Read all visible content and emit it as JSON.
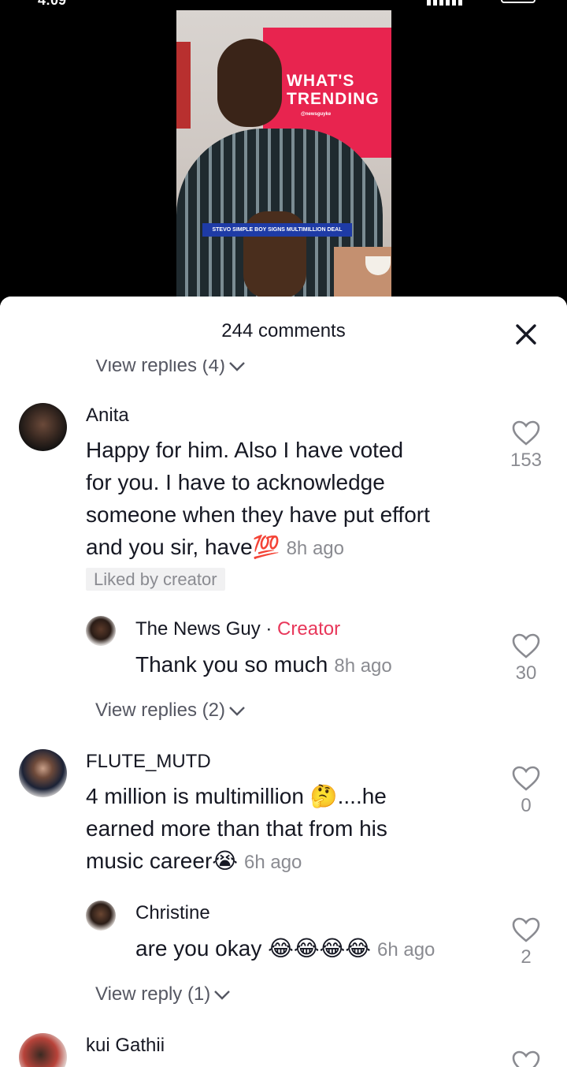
{
  "status_bar": {
    "time": "4:09"
  },
  "video": {
    "screen_title_line1": "WHAT'S",
    "screen_title_line2": "TRENDING",
    "screen_handle": "@newsguyke",
    "caption": "STEVO SIMPLE BOY SIGNS MULTIMILLION DEAL"
  },
  "sheet": {
    "title": "244 comments"
  },
  "partial_replies": {
    "label": "View replies (4)"
  },
  "comments": [
    {
      "username": "Anita",
      "text": "Happy for him. Also I have voted for you. I have to acknowledge someone when they have put effort and you sir, have💯",
      "line1": "Happy for him. Also I have voted",
      "line2": "for you. I have to acknowledge",
      "line3": "someone when they have put effort",
      "line4": "and you sir, have",
      "emoji": "💯",
      "time": "8h ago",
      "badge": "Liked by creator",
      "likes": "153"
    },
    {
      "username": "The News Guy",
      "separator": " · ",
      "creator_label": "Creator",
      "text": "Thank you so much",
      "time": "8h ago",
      "likes": "30"
    },
    {
      "username": "FLUTE_MUTD",
      "line1": "4 million is multimillion ",
      "emoji1": "🤔",
      "line1b": "....he",
      "line2": "earned more than that from his",
      "line3": "music career",
      "emoji2": "😭",
      "time": "6h ago",
      "likes": "0"
    },
    {
      "username": "Christine",
      "text": "are you okay ",
      "emoji": "😂😂😂😂",
      "time": "6h ago",
      "likes": "2"
    },
    {
      "username": "kui Gathii"
    }
  ],
  "view_replies_2": "View replies (2)",
  "view_reply_1": "View reply (1)",
  "colors": {
    "creator": "#e8375a",
    "text": "#161823",
    "muted": "#8a8b91"
  }
}
